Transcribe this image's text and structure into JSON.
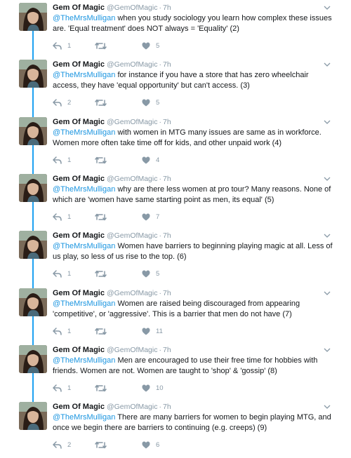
{
  "author": {
    "name": "Gem Of Magic",
    "handle": "@GemOfMagic",
    "dot": "·"
  },
  "colors": {
    "accent": "#1da1f2",
    "mention": "#1b95e0",
    "muted": "#8899a6",
    "text": "#14171a"
  },
  "tweets": [
    {
      "time": "7h",
      "mention": "@TheMrsMulligan",
      "text": " when you study sociology you learn how complex these issues are. 'Equal treatment' does NOT always = 'Equality' (2)",
      "replies": "1",
      "retweets": "",
      "likes": "5"
    },
    {
      "time": "7h",
      "mention": "@TheMrsMulligan",
      "text": " for instance if you have a store that has zero wheelchair access, they have 'equal opportunity' but can't access. (3)",
      "replies": "2",
      "retweets": "",
      "likes": "5"
    },
    {
      "time": "7h",
      "mention": "@TheMrsMulligan",
      "text": " with women in MTG many issues are same as in workforce. Women more often take time off for kids, and other unpaid work (4)",
      "replies": "1",
      "retweets": "",
      "likes": "4"
    },
    {
      "time": "7h",
      "mention": "@TheMrsMulligan",
      "text": " why are there less women at pro tour? Many reasons. None of which are 'women have same starting point as men, its equal' (5)",
      "replies": "1",
      "retweets": "",
      "likes": "7"
    },
    {
      "time": "7h",
      "mention": "@TheMrsMulligan",
      "text": " Women have barriers to beginning playing magic at all. Less of us play, so less of us rise to the top. (6)",
      "replies": "1",
      "retweets": "",
      "likes": "5"
    },
    {
      "time": "7h",
      "mention": "@TheMrsMulligan",
      "text": " Women are raised being discouraged from appearing 'competitive', or 'aggressive'. This is a barrier that men do not have (7)",
      "replies": "1",
      "retweets": "",
      "likes": "11"
    },
    {
      "time": "7h",
      "mention": "@TheMrsMulligan",
      "text": " Men are encouraged to use their free time for hobbies with friends. Women are not. Women are taught to 'shop' & 'gossip' (8)",
      "replies": "1",
      "retweets": "",
      "likes": "10"
    },
    {
      "time": "7h",
      "mention": "@TheMrsMulligan",
      "text": " There are many barriers for women to begin playing MTG, and once we begin there are barriers to continuing (e.g. creeps) (9)",
      "replies": "2",
      "retweets": "",
      "likes": "6"
    }
  ]
}
